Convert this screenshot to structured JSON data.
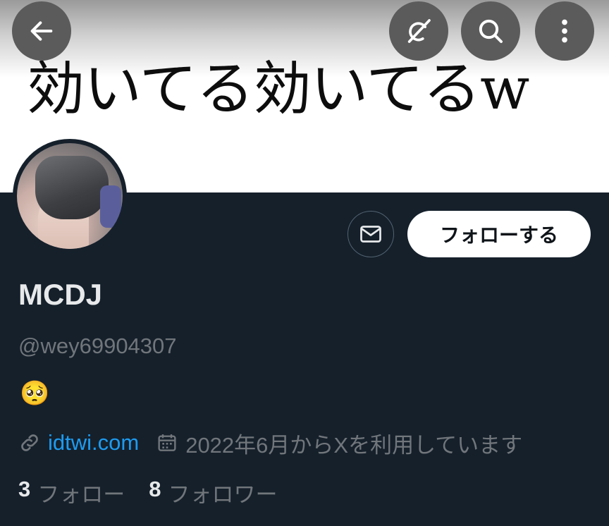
{
  "banner": {
    "text": "効いてる効いてるw"
  },
  "top_bar": {
    "back_icon": "arrow-left-icon",
    "grok_icon": "grok-icon",
    "search_icon": "search-icon",
    "more_icon": "more-vertical-icon"
  },
  "profile": {
    "display_name": "MCDJ",
    "handle": "@wey69904307",
    "bio": "🥺",
    "link": "idtwi.com",
    "joined": "2022年6月からXを利用しています",
    "following_count": "3",
    "following_label": "フォロー",
    "followers_count": "8",
    "followers_label": "フォロワー"
  },
  "actions": {
    "message_icon": "mail-icon",
    "follow_label": "フォローする"
  },
  "colors": {
    "background": "#15202b",
    "link": "#1d9bf0",
    "secondary_text": "#71767b"
  }
}
